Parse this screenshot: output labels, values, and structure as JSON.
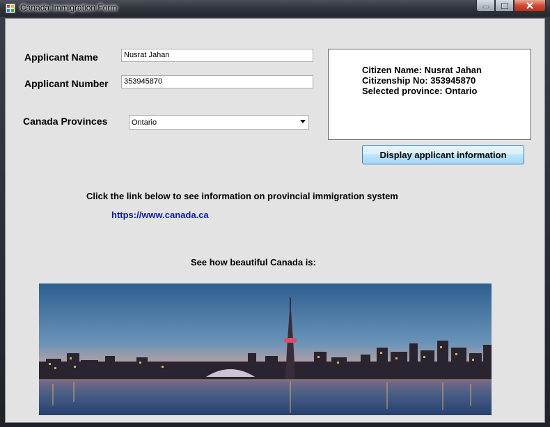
{
  "window": {
    "title": "Canada Immigration Form"
  },
  "form": {
    "applicant_name_label": "Applicant Name",
    "applicant_name_value": "Nusrat Jahan",
    "applicant_number_label": "Applicant Number",
    "applicant_number_value": "353945870",
    "provinces_label": "Canada Provinces",
    "province_selected": "Ontario"
  },
  "info": {
    "line1": "Citizen Name: Nusrat Jahan",
    "line2": "Citizenship No: 353945870",
    "line3": "Selected province:  Ontario"
  },
  "display_button_label": "Display applicant information",
  "link_intro": "Click the link below to see  information on provincial immigration system",
  "link_text": "https://www.canada.ca",
  "photo_caption": "See how beautiful Canada is:",
  "colors": {
    "link": "#0a1fa0",
    "client_bg": "#e3e3e3",
    "button_border": "#3c7fb1"
  }
}
